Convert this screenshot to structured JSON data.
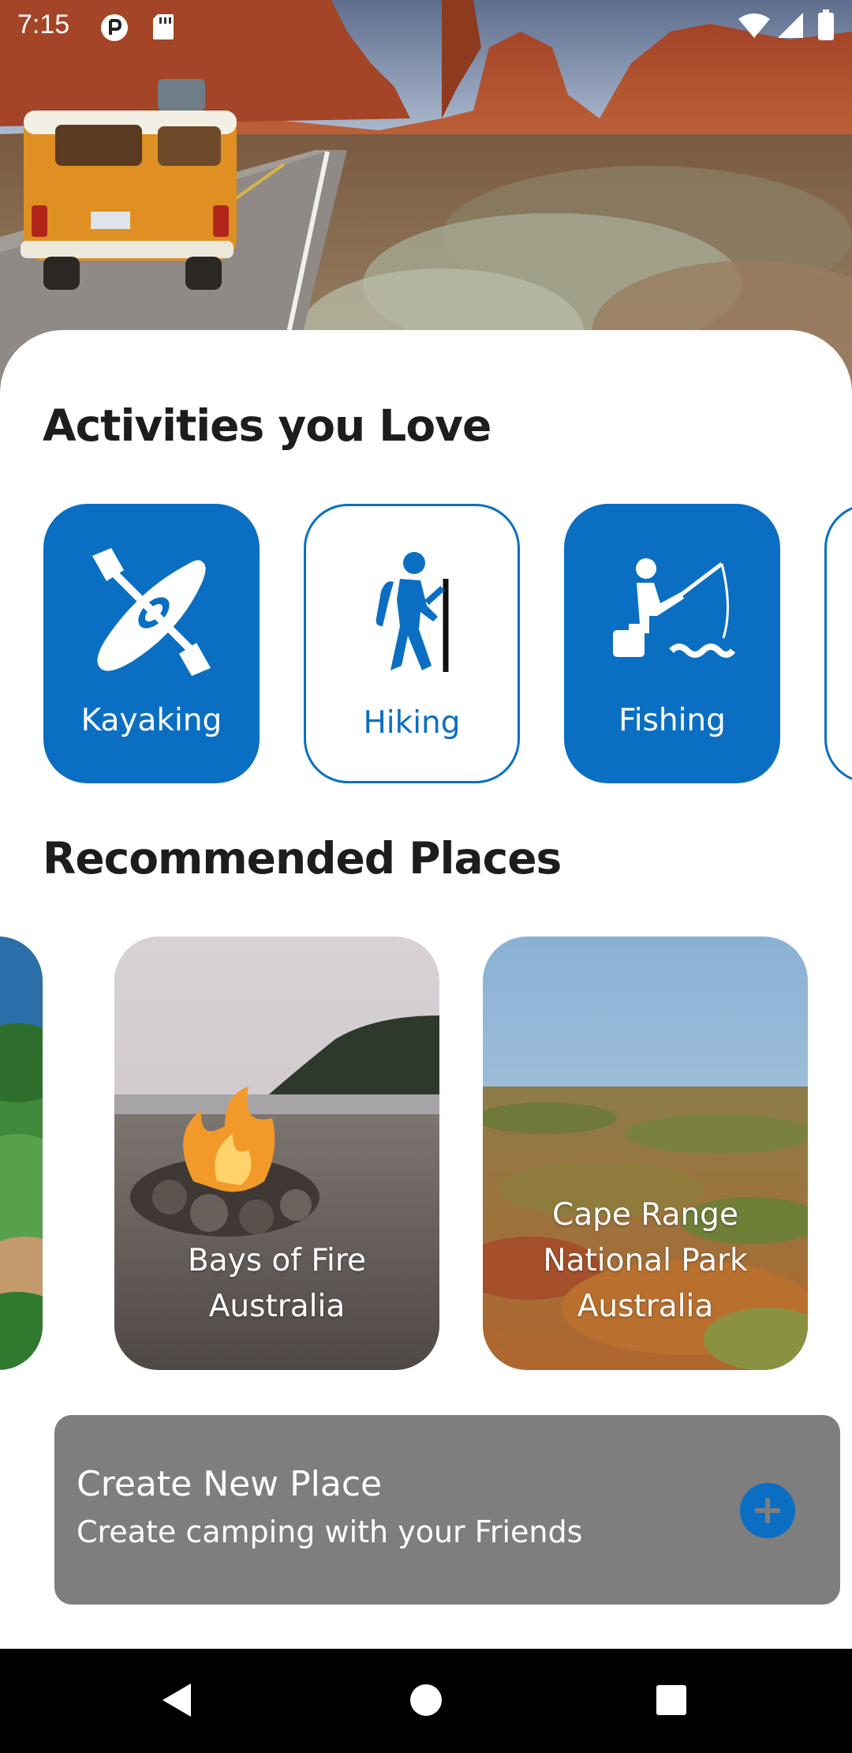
{
  "status_bar": {
    "time": "7:15",
    "icons": [
      "notification-p-icon",
      "sd-card-icon",
      "wifi-icon",
      "cellular-signal-icon",
      "battery-icon"
    ]
  },
  "hero": {
    "image": "desert-road-with-orange-camper-van"
  },
  "activities": {
    "title": "Activities you Love",
    "items": [
      {
        "label": "Kayaking",
        "icon": "kayak-icon",
        "selected": true
      },
      {
        "label": "Hiking",
        "icon": "hiker-icon",
        "selected": false
      },
      {
        "label": "Fishing",
        "icon": "fishing-icon",
        "selected": true
      }
    ]
  },
  "recommended": {
    "title": "Recommended Places",
    "places": [
      {
        "line1": "Bays of Fire",
        "line2": "Australia",
        "image": "beach-campfire"
      },
      {
        "line1": "Cape Range",
        "line2": "National Park",
        "line3": "Australia",
        "image": "outback-scrubland"
      }
    ]
  },
  "create_place": {
    "title": "Create New Place",
    "subtitle": "Create camping with your Friends",
    "button_icon": "plus-icon"
  },
  "nav": {
    "back": "back-triangle-icon",
    "home": "home-circle-icon",
    "recents": "recents-square-icon"
  },
  "colors": {
    "accent": "#0a6fc2",
    "banner": "#7e7e7e",
    "title_text": "#1d1d1d"
  }
}
